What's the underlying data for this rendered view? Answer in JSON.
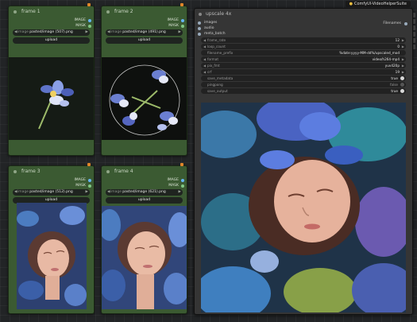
{
  "frames": [
    {
      "title": "frame 1",
      "output_image": "IMAGE",
      "output_mask": "MASK",
      "image_key": "image",
      "image_value": "pasted/image (507).png",
      "upload": "upload"
    },
    {
      "title": "frame 2",
      "output_image": "IMAGE",
      "output_mask": "MASK",
      "image_key": "image",
      "image_value": "pasted/image (491).png",
      "upload": "upload"
    },
    {
      "title": "frame 3",
      "output_image": "IMAGE",
      "output_mask": "MASK",
      "image_key": "image",
      "image_value": "pasted/image (512).png",
      "upload": "upload"
    },
    {
      "title": "frame 4",
      "output_image": "IMAGE",
      "output_mask": "MASK",
      "image_key": "image",
      "image_value": "pasted/image (621).png",
      "upload": "upload"
    }
  ],
  "video_node": {
    "title": "upscale 4x",
    "inputs": [
      "images",
      "audio",
      "meta_batch"
    ],
    "output": "Filenames",
    "widgets": [
      {
        "key": "frame_rate",
        "value": "12"
      },
      {
        "key": "loop_count",
        "value": "0"
      },
      {
        "key": "filename_prefix",
        "value": "%date:yyyy-MM-dd%/upscaled_mod"
      },
      {
        "key": "format",
        "value": "video/h264-mp4"
      },
      {
        "key": "pix_fmt",
        "value": "yuv420p"
      },
      {
        "key": "crf",
        "value": "19"
      },
      {
        "key": "save_metadata",
        "value": "true"
      },
      {
        "key": "pingpong",
        "value": "false"
      },
      {
        "key": "save_output",
        "value": "true"
      }
    ]
  },
  "topbar": {
    "label": "ComfyUI-VideoHelperSuite"
  },
  "colors": {
    "node_green": "#3b5a32",
    "port_image": "#64b5f6",
    "port_mask": "#81c784",
    "toggle_on": "#d8d8d8",
    "toggle_off": "#555555",
    "accent": "#e0862a"
  }
}
